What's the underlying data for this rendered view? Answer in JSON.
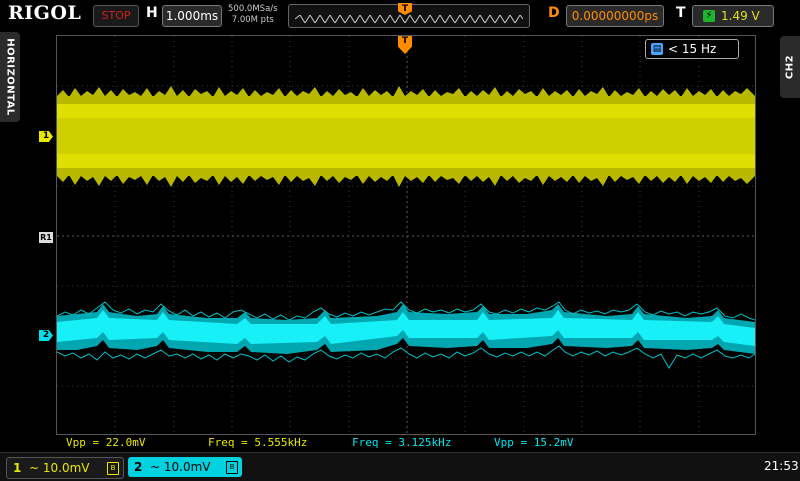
{
  "top": {
    "brand": "RIGOL",
    "run_state": "STOP",
    "timebase_label": "H",
    "timebase": "1.000ms",
    "sample_rate": "500.0MSa/s",
    "memory_depth": "7.00M pts",
    "trigger_marker": "T",
    "delay_label": "D",
    "delay": "0.00000000ps",
    "trigger_label": "T",
    "trigger_level": "1.49 V"
  },
  "side": {
    "left_tab": "HORIZONTAL",
    "right_tab": "CH2"
  },
  "screen": {
    "trigger_position_marker": "T",
    "filter": "< 15 Hz",
    "ch1_marker": "1",
    "ch2_marker": "2",
    "ref_marker": "R1"
  },
  "measurements": [
    {
      "text": "Vpp = 22.0mV",
      "color": "#e8e800"
    },
    {
      "text": "Freq = 5.555kHz",
      "color": "#e8e800"
    },
    {
      "text": "Freq = 3.125kHz",
      "color": "#00e8f0"
    },
    {
      "text": "Vpp = 15.2mV",
      "color": "#00e8f0"
    }
  ],
  "bottom": {
    "ch1": {
      "num": "1",
      "coupling": "~",
      "scale": "10.0mV"
    },
    "ch2": {
      "num": "2",
      "coupling": "~",
      "scale": "10.0mV"
    },
    "clock": "21:53"
  },
  "colors": {
    "ch1": "#e8e800",
    "ch2": "#00e0e8",
    "trigger": "#ff8c00",
    "stop": "#d02020",
    "background": "#000000"
  }
}
